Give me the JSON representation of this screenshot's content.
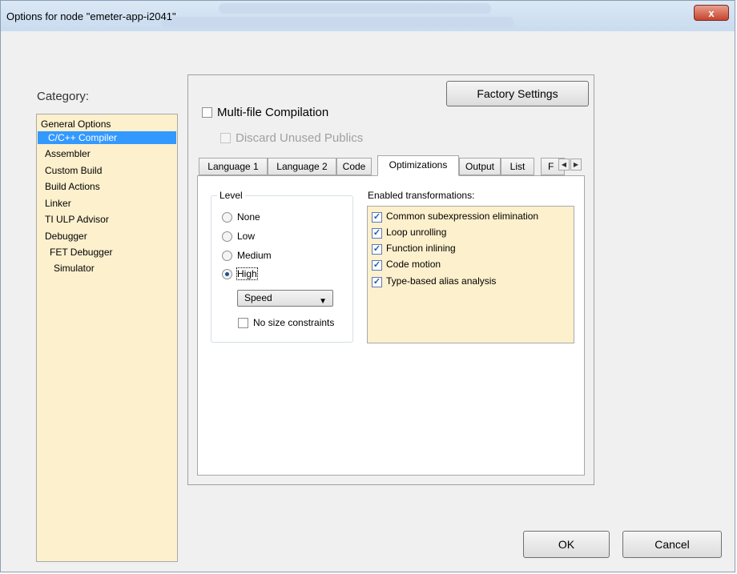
{
  "window": {
    "title": "Options for node \"emeter-app-i2041\"",
    "close_glyph": "x"
  },
  "category": {
    "label": "Category:",
    "items": [
      {
        "label": "General Options"
      },
      {
        "label": "C/C++ Compiler"
      },
      {
        "label": "Assembler"
      },
      {
        "label": "Custom Build"
      },
      {
        "label": "Build Actions"
      },
      {
        "label": "Linker"
      },
      {
        "label": "TI ULP Advisor"
      },
      {
        "label": "Debugger"
      },
      {
        "label": "FET Debugger"
      },
      {
        "label": "Simulator"
      }
    ],
    "selected": "C/C++ Compiler"
  },
  "panel": {
    "factory_settings_label": "Factory Settings",
    "multi_file_label": "Multi-file Compilation",
    "multi_file_checked": false,
    "discard_label": "Discard Unused Publics",
    "discard_enabled": false
  },
  "tabs": [
    {
      "label": "Language 1"
    },
    {
      "label": "Language 2"
    },
    {
      "label": "Code"
    },
    {
      "label": "Optimizations"
    },
    {
      "label": "Output"
    },
    {
      "label": "List"
    },
    {
      "label": "F"
    }
  ],
  "active_tab": "Optimizations",
  "level": {
    "title": "Level",
    "options": [
      {
        "label": "None"
      },
      {
        "label": "Low"
      },
      {
        "label": "Medium"
      },
      {
        "label": "High"
      }
    ],
    "selected": "High",
    "goal": "Speed",
    "no_size_label": "No size constraints",
    "no_size_checked": false
  },
  "transformations": {
    "title": "Enabled transformations:",
    "items": [
      {
        "label": "Common subexpression elimination",
        "checked": true
      },
      {
        "label": "Loop unrolling",
        "checked": true
      },
      {
        "label": "Function inlining",
        "checked": true
      },
      {
        "label": "Code motion",
        "checked": true
      },
      {
        "label": "Type-based alias analysis",
        "checked": true
      }
    ]
  },
  "buttons": {
    "ok": "OK",
    "cancel": "Cancel"
  },
  "icons": {
    "checkmark": "✓",
    "dropdown": "▼",
    "scroll_left": "◀",
    "scroll_right": "▶"
  },
  "colors": {
    "list_bg": "#fdf0cd",
    "selection": "#3399ff"
  }
}
